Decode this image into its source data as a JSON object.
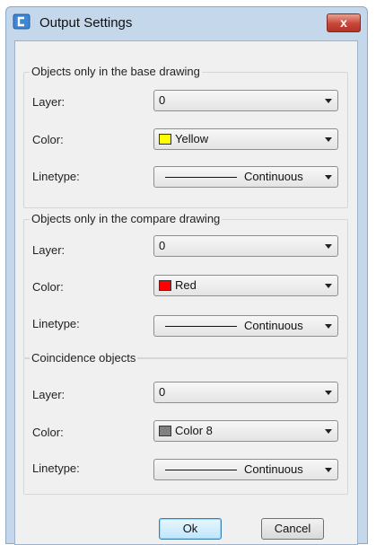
{
  "window": {
    "title": "Output Settings",
    "close_glyph": "x",
    "icon": "app-icon",
    "accent": "#4a8fd6"
  },
  "groups": [
    {
      "legend": "Objects only in the base drawing",
      "layer_label": "Layer:",
      "layer_value": "0",
      "color_label": "Color:",
      "color_value": "Yellow",
      "color_hex": "#ffff00",
      "linetype_label": "Linetype:",
      "linetype_value": "Continuous"
    },
    {
      "legend": "Objects only in the compare drawing",
      "layer_label": "Layer:",
      "layer_value": "0",
      "color_label": "Color:",
      "color_value": "Red",
      "color_hex": "#ff0000",
      "linetype_label": "Linetype:",
      "linetype_value": "Continuous"
    },
    {
      "legend": "Coincidence objects",
      "layer_label": "Layer:",
      "layer_value": "0",
      "color_label": "Color:",
      "color_value": "Color 8",
      "color_hex": "#808080",
      "linetype_label": "Linetype:",
      "linetype_value": "Continuous"
    }
  ],
  "buttons": {
    "ok": "Ok",
    "cancel": "Cancel"
  }
}
